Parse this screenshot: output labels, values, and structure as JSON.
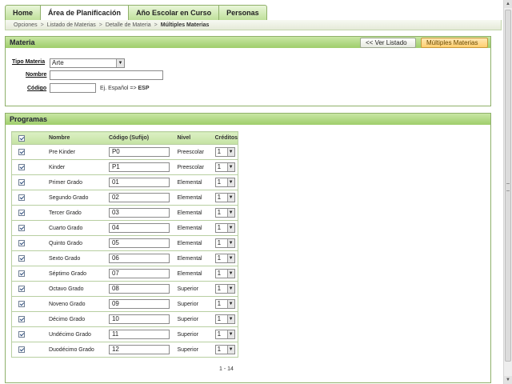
{
  "tabs": [
    "Home",
    "Área de Planificación",
    "Año Escolar en Curso",
    "Personas"
  ],
  "breadcrumb": [
    "Opciones",
    "Listado de Materias",
    "Detalle de Materia",
    "Múltiples Materias"
  ],
  "materia": {
    "title": "Materia",
    "btn_listado": "<< Ver Listado",
    "btn_multiples": "Múltiples Materias",
    "tipo_label": "Tipo Materia",
    "tipo_value": "Arte",
    "nombre_label": "Nombre",
    "nombre_value": "",
    "codigo_label": "Código",
    "codigo_value": "",
    "hint": "Ej. Español =>",
    "hint_bold": "ESP"
  },
  "programas": {
    "title": "Programas",
    "columns": [
      "Nombre",
      "Código (Sufijo)",
      "Nivel",
      "Créditos"
    ],
    "rows": [
      {
        "nombre": "Pre Kinder",
        "codigo": "P0",
        "nivel": "Preescolar",
        "creditos": "1"
      },
      {
        "nombre": "Kinder",
        "codigo": "P1",
        "nivel": "Preescolar",
        "creditos": "1"
      },
      {
        "nombre": "Primer Grado",
        "codigo": "01",
        "nivel": "Elemental",
        "creditos": "1"
      },
      {
        "nombre": "Segundo Grado",
        "codigo": "02",
        "nivel": "Elemental",
        "creditos": "1"
      },
      {
        "nombre": "Tercer Grado",
        "codigo": "03",
        "nivel": "Elemental",
        "creditos": "1"
      },
      {
        "nombre": "Cuarto Grado",
        "codigo": "04",
        "nivel": "Elemental",
        "creditos": "1"
      },
      {
        "nombre": "Quinto Grado",
        "codigo": "05",
        "nivel": "Elemental",
        "creditos": "1"
      },
      {
        "nombre": "Sexto Grado",
        "codigo": "06",
        "nivel": "Elemental",
        "creditos": "1"
      },
      {
        "nombre": "Séptimo Grado",
        "codigo": "07",
        "nivel": "Elemental",
        "creditos": "1"
      },
      {
        "nombre": "Octavo Grado",
        "codigo": "08",
        "nivel": "Superior",
        "creditos": "1"
      },
      {
        "nombre": "Noveno Grado",
        "codigo": "09",
        "nivel": "Superior",
        "creditos": "1"
      },
      {
        "nombre": "Décimo Grado",
        "codigo": "10",
        "nivel": "Superior",
        "creditos": "1"
      },
      {
        "nombre": "Undécimo Grado",
        "codigo": "11",
        "nivel": "Superior",
        "creditos": "1"
      },
      {
        "nombre": "Duodécimo Grado",
        "codigo": "12",
        "nivel": "Superior",
        "creditos": "1"
      }
    ],
    "pager": "1 - 14"
  },
  "icons": {
    "dropdown": "chevron-down-icon",
    "checkbox": "checkbox-checked-icon"
  }
}
